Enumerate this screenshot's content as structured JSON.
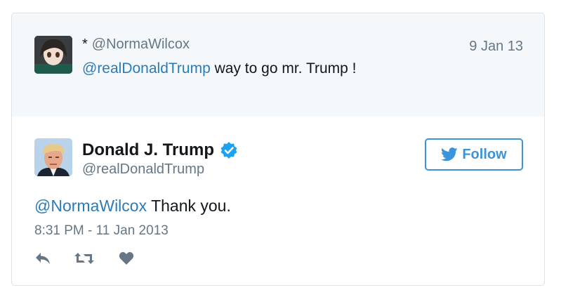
{
  "parent_tweet": {
    "marker": "*",
    "handle": "@NormaWilcox",
    "date": "9 Jan 13",
    "mention": "@realDonaldTrump",
    "text": " way to go mr. Trump !"
  },
  "main_tweet": {
    "name": "Donald J. Trump",
    "handle": "@realDonaldTrump",
    "verified": true,
    "mention": "@NormaWilcox",
    "text": " Thank you.",
    "timestamp": "8:31 PM - 11 Jan 2013"
  },
  "follow_button": {
    "label": "Follow"
  },
  "actions": [
    "reply-icon",
    "retweet-icon",
    "like-icon"
  ],
  "colors": {
    "link": "#2b7bb9",
    "accent": "#3b94d9",
    "muted": "#657786",
    "parent_bg": "#f5f8fa"
  }
}
